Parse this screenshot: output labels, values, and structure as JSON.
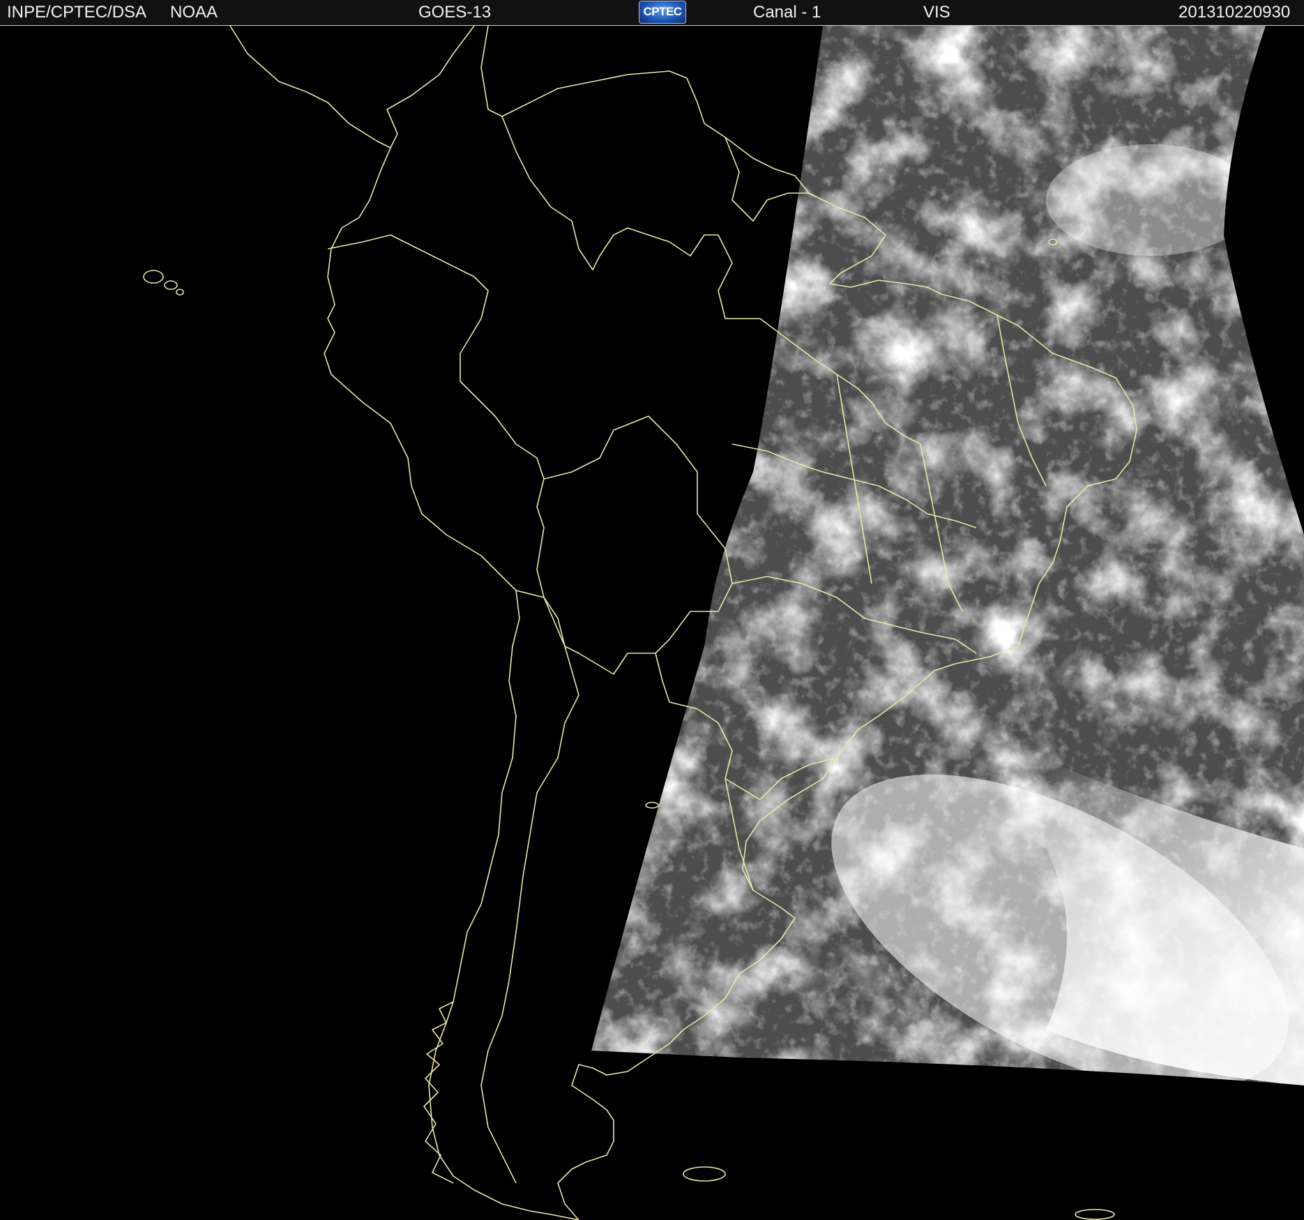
{
  "header": {
    "agency": "INPE/CPTEC/DSA",
    "provider": "NOAA",
    "satellite": "GOES-13",
    "logo_text": "CPTEC",
    "channel": "Canal - 1",
    "band": "VIS",
    "timestamp": "201310220930"
  },
  "map": {
    "region": "South America",
    "background": "#000000",
    "coastline_color": "#e8e8a8",
    "cloud_color": "#ffffff",
    "ocean_color": "#4a4a4a"
  }
}
